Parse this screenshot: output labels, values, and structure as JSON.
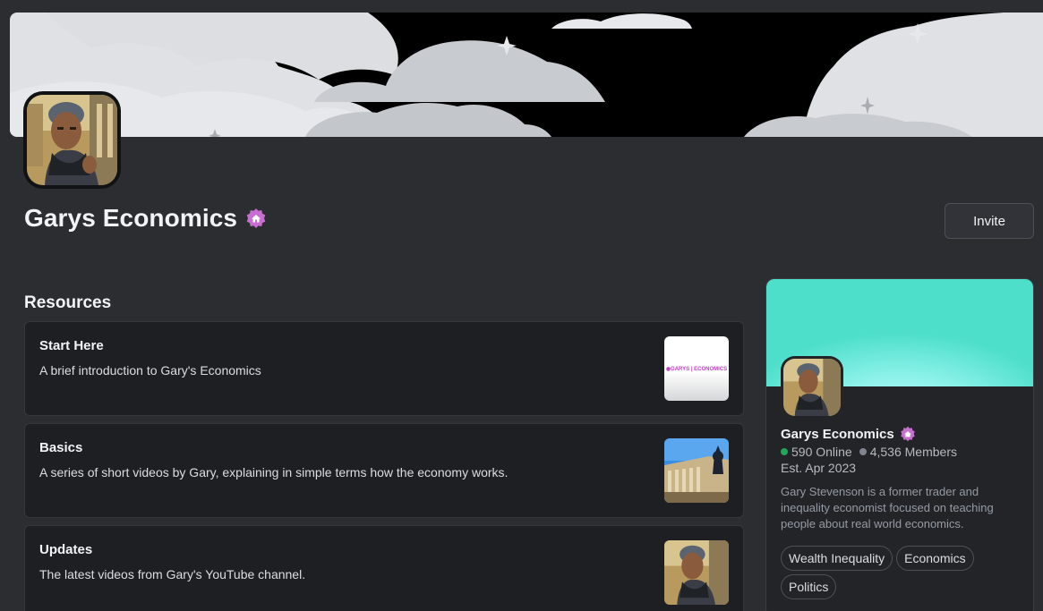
{
  "server": {
    "name": "Garys Economics",
    "badge_icon": "server-badge-icon",
    "invite_label": "Invite"
  },
  "resources": {
    "title": "Resources",
    "items": [
      {
        "title": "Start Here",
        "description": "A brief introduction to Gary's Economics",
        "thumb_text": "◉GARYS | ECONOMICS"
      },
      {
        "title": "Basics",
        "description": "A series of short videos by Gary, explaining in simple terms how the economy works."
      },
      {
        "title": "Updates",
        "description": "The latest videos from Gary's YouTube channel."
      }
    ]
  },
  "card": {
    "name": "Garys Economics",
    "online": "590 Online",
    "members": "4,536 Members",
    "established": "Est. Apr 2023",
    "description": "Gary Stevenson is a former trader and inequality economist focused on teaching people about real world economics.",
    "tags": [
      "Wealth Inequality",
      "Economics",
      "Politics"
    ]
  },
  "colors": {
    "background": "#2b2d31",
    "card_banner": "#4ddfca",
    "online_dot": "#23a55a",
    "badge": "#c76fd0"
  }
}
